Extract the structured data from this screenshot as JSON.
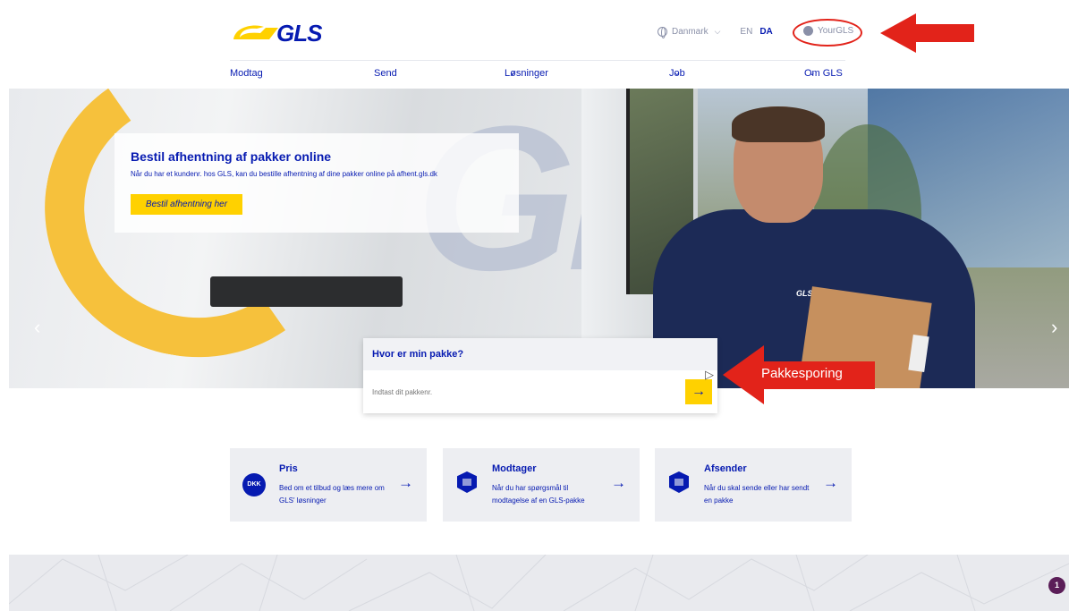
{
  "header": {
    "logo_text": "GLS",
    "country": "Danmark",
    "languages": [
      "EN",
      "DA"
    ],
    "active_language": "DA",
    "account_label": "YourGLS"
  },
  "nav": {
    "items": [
      {
        "label": "Modtag",
        "dropdown": false
      },
      {
        "label": "Send",
        "dropdown": false
      },
      {
        "label": "Løsninger",
        "dropdown": true
      },
      {
        "label": "Job",
        "dropdown": true
      },
      {
        "label": "Om GLS",
        "dropdown": true
      }
    ]
  },
  "hero": {
    "title": "Bestil afhentning af pakker online",
    "text": "Når du har et kundenr. hos GLS, kan du bestille afhentning af dine pakker online på afhent.gls.dk",
    "button_label": "Bestil afhentning her",
    "badge_text": "GLS",
    "prev_icon": "chevron-left-icon",
    "next_icon": "chevron-right-icon"
  },
  "tracking": {
    "title": "Hvor er min pakke?",
    "placeholder": "Indtast dit pakkenr.",
    "submit_icon": "arrow-right-icon"
  },
  "annotation": {
    "label": "Pakkesporing",
    "color": "#e2231a"
  },
  "cards": [
    {
      "icon": "DKK",
      "title": "Pris",
      "text": "Bed om et tilbud og læs mere om GLS' løsninger"
    },
    {
      "icon": "package-icon",
      "title": "Modtager",
      "text": "Når du har spørgsmål til modtagelse af en GLS-pakke"
    },
    {
      "icon": "package-send-icon",
      "title": "Afsender",
      "text": "Når du skal sende eller har sendt en pakke"
    }
  ],
  "notification_count": "1",
  "colors": {
    "brand_blue": "#061ab1",
    "brand_yellow": "#ffd100",
    "annotation_red": "#e2231a"
  }
}
